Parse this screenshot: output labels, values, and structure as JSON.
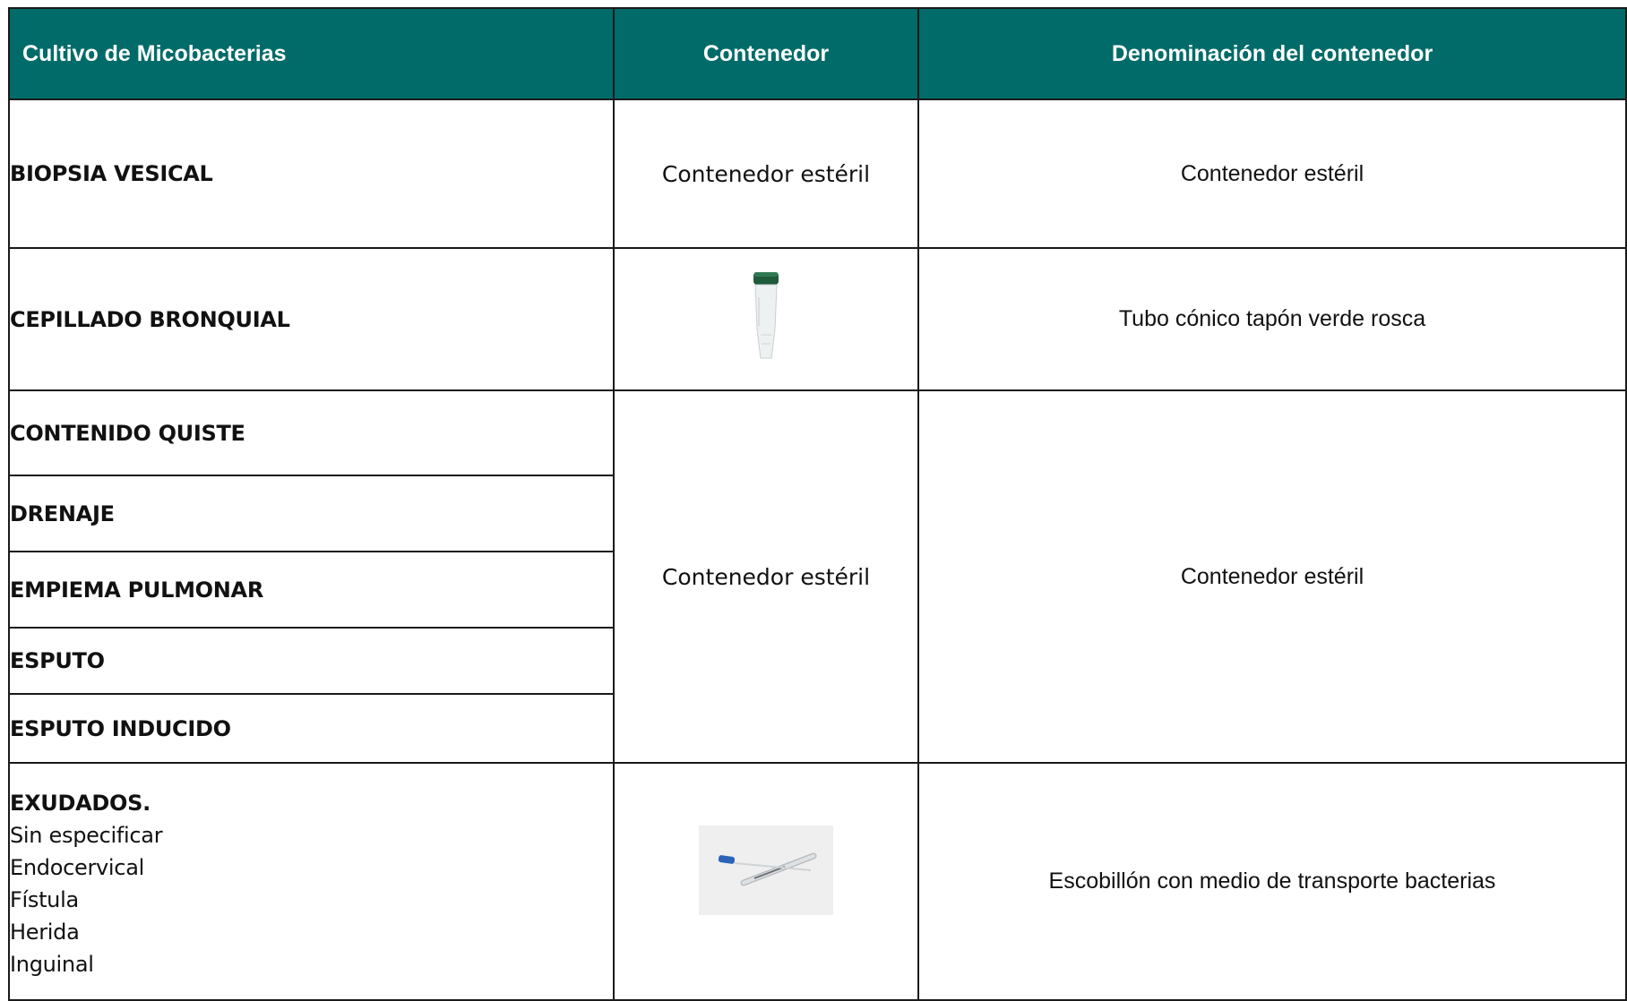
{
  "header": {
    "col1": "Cultivo de Micobacterias",
    "col2": "Contenedor",
    "col3": "Denominación del contenedor"
  },
  "rows": {
    "r1": {
      "label": "BIOPSIA VESICAL",
      "container": "Contenedor estéril",
      "denomination": "Contenedor estéril"
    },
    "r2": {
      "label": "CEPILLADO BRONQUIAL",
      "container_image": "green-cap-conical-tube",
      "denomination": "Tubo cónico tapón verde rosca"
    },
    "group": {
      "labels": [
        "CONTENIDO QUISTE",
        "DRENAJE",
        "EMPIEMA PULMONAR",
        "ESPUTO",
        "ESPUTO INDUCIDO"
      ],
      "container": "Contenedor estéril",
      "denomination": "Contenedor estéril"
    },
    "r8": {
      "label": "EXUDADOS.",
      "sublabels": [
        "Sin especificar",
        "Endocervical",
        "Fístula",
        "Herida",
        "Inguinal"
      ],
      "container_image": "swab-transport-tube",
      "denomination": "Escobillón con medio de transporte bacterias"
    }
  },
  "colors": {
    "header_bg": "#006b68",
    "header_text": "#ffffff",
    "cap_green": "#1f5a3a",
    "swab_blue": "#2a63b8"
  }
}
